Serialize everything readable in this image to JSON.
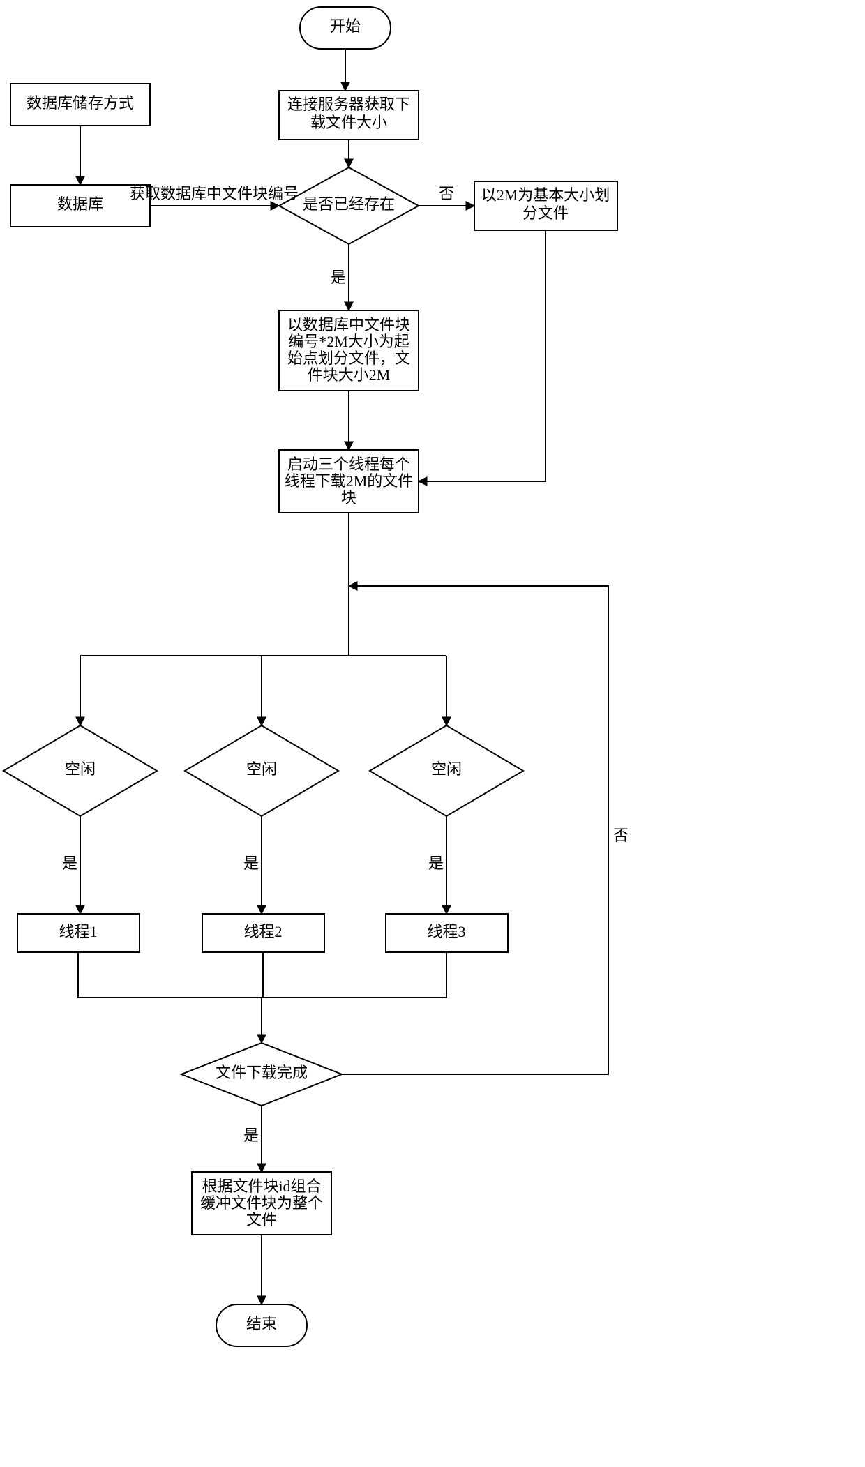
{
  "nodes": {
    "start": {
      "label": "开始"
    },
    "connect": {
      "l1": "连接服务器获取下",
      "l2": "载文件大小"
    },
    "storeMethod": {
      "label": "数据库储存方式"
    },
    "database": {
      "label": "数据库"
    },
    "exists": {
      "label": "是否已经存在"
    },
    "split2m": {
      "l1": "以2M为基本大小划",
      "l2": "分文件"
    },
    "fromId": {
      "l1": "以数据库中文件块",
      "l2": "编号*2M大小为起",
      "l3": "始点划分文件，文",
      "l4": "件块大小2M"
    },
    "startThreads": {
      "l1": "启动三个线程每个",
      "l2": "线程下载2M的文件",
      "l3": "块"
    },
    "idle1": {
      "label": "空闲"
    },
    "idle2": {
      "label": "空闲"
    },
    "idle3": {
      "label": "空闲"
    },
    "thread1": {
      "label": "线程1"
    },
    "thread2": {
      "label": "线程2"
    },
    "thread3": {
      "label": "线程3"
    },
    "done": {
      "label": "文件下载完成"
    },
    "combine": {
      "l1": "根据文件块id组合",
      "l2": "缓冲文件块为整个",
      "l3": "文件"
    },
    "end": {
      "label": "结束"
    }
  },
  "edges": {
    "dbLabel": "获取数据库中文件块编号",
    "yes": "是",
    "no": "否"
  }
}
